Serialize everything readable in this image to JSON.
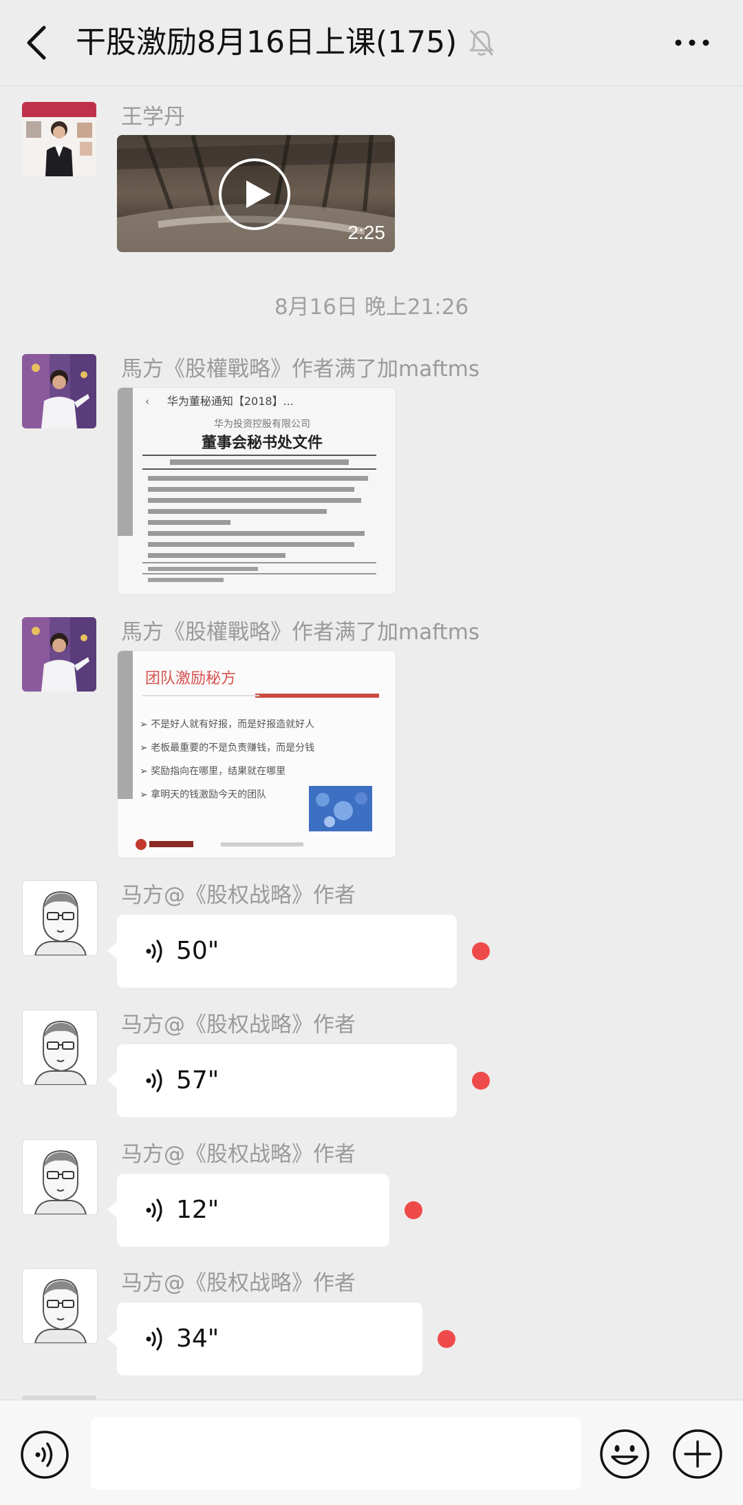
{
  "header": {
    "title": "干股激励8月16日上课(175)",
    "back_icon": "chevron-left-icon",
    "muted_icon": "bell-off-icon",
    "more_icon": "ellipsis-icon"
  },
  "messages": [
    {
      "type": "video",
      "sender": "王学丹",
      "video": {
        "duration": "2:25",
        "play_icon": "play-icon"
      }
    },
    {
      "type": "time",
      "text": "8月16日 晚上21:26"
    },
    {
      "type": "image",
      "sender": "馬方《股權戰略》作者满了加maftms",
      "image": {
        "top_title": "华为董秘通知【2018】...",
        "org": "华为投资控股有限公司",
        "heading": "董事会秘书处文件"
      }
    },
    {
      "type": "image",
      "sender": "馬方《股權戰略》作者满了加maftms",
      "image": {
        "slide_title": "团队激励秘方",
        "bullets": [
          "不是好人就有好报，而是好报造就好人",
          "老板最重要的不是负责赚钱，而是分钱",
          "奖励指向在哪里，结果就在哪里",
          "拿明天的钱激励今天的团队"
        ]
      }
    },
    {
      "type": "voice",
      "sender": "马方@《股权战略》作者",
      "duration": "50\"",
      "unread": true
    },
    {
      "type": "voice",
      "sender": "马方@《股权战略》作者",
      "duration": "57\"",
      "unread": true
    },
    {
      "type": "voice",
      "sender": "马方@《股权战略》作者",
      "duration": "12\"",
      "unread": true
    },
    {
      "type": "voice",
      "sender": "马方@《股权战略》作者",
      "duration": "34\"",
      "unread": true
    }
  ],
  "input_bar": {
    "voice_icon": "voice-mode-icon",
    "emoji_icon": "emoji-icon",
    "plus_icon": "plus-circle-icon",
    "text_value": ""
  },
  "colors": {
    "background": "#ededed",
    "bubble": "#ffffff",
    "unread_dot": "#ef4a4a",
    "sender_text": "#9a9a9a"
  }
}
